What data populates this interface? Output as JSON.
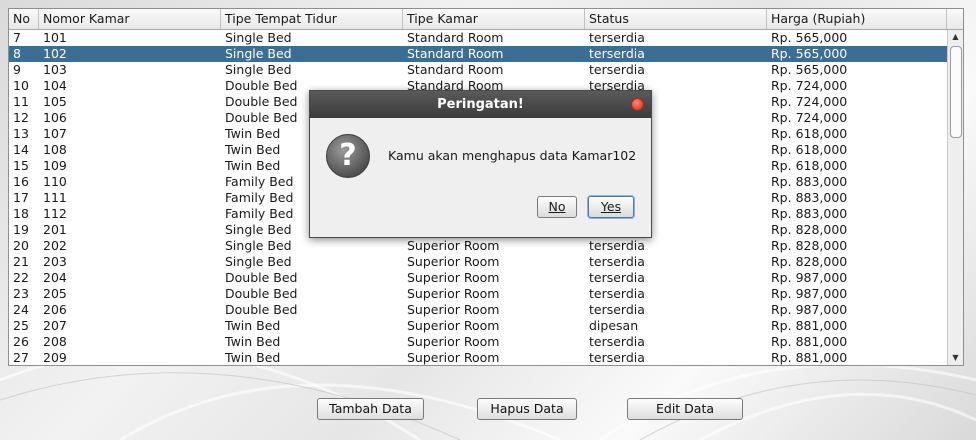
{
  "table": {
    "columns": [
      "No",
      "Nomor Kamar",
      "Tipe Tempat Tidur",
      "Tipe Kamar",
      "Status",
      "Harga (Rupiah)"
    ],
    "rows": [
      [
        "7",
        "101",
        "Single Bed",
        "Standard Room",
        "terserdia",
        "Rp. 565,000"
      ],
      [
        "8",
        "102",
        "Single Bed",
        "Standard Room",
        "terserdia",
        "Rp. 565,000"
      ],
      [
        "9",
        "103",
        "Single Bed",
        "Standard Room",
        "terserdia",
        "Rp. 565,000"
      ],
      [
        "10",
        "104",
        "Double Bed",
        "Standard Room",
        "terserdia",
        "Rp. 724,000"
      ],
      [
        "11",
        "105",
        "Double Bed",
        "",
        "",
        "Rp. 724,000"
      ],
      [
        "12",
        "106",
        "Double Bed",
        "",
        "",
        "Rp. 724,000"
      ],
      [
        "13",
        "107",
        "Twin Bed",
        "",
        "",
        "Rp. 618,000"
      ],
      [
        "14",
        "108",
        "Twin Bed",
        "",
        "",
        "Rp. 618,000"
      ],
      [
        "15",
        "109",
        "Twin Bed",
        "",
        "",
        "Rp. 618,000"
      ],
      [
        "16",
        "110",
        "Family Bed",
        "",
        "",
        "Rp. 883,000"
      ],
      [
        "17",
        "111",
        "Family Bed",
        "",
        "",
        "Rp. 883,000"
      ],
      [
        "18",
        "112",
        "Family Bed",
        "",
        "",
        "Rp. 883,000"
      ],
      [
        "19",
        "201",
        "Single Bed",
        "",
        "",
        "Rp. 828,000"
      ],
      [
        "20",
        "202",
        "Single Bed",
        "Superior Room",
        "terserdia",
        "Rp. 828,000"
      ],
      [
        "21",
        "203",
        "Single Bed",
        "Superior Room",
        "terserdia",
        "Rp. 828,000"
      ],
      [
        "22",
        "204",
        "Double Bed",
        "Superior Room",
        "terserdia",
        "Rp. 987,000"
      ],
      [
        "23",
        "205",
        "Double Bed",
        "Superior Room",
        "terserdia",
        "Rp. 987,000"
      ],
      [
        "24",
        "206",
        "Double Bed",
        "Superior Room",
        "terserdia",
        "Rp. 987,000"
      ],
      [
        "25",
        "207",
        "Twin Bed",
        "Superior Room",
        "dipesan",
        "Rp. 881,000"
      ],
      [
        "26",
        "208",
        "Twin Bed",
        "Superior Room",
        "terserdia",
        "Rp. 881,000"
      ],
      [
        "27",
        "209",
        "Twin Bed",
        "Superior Room",
        "terserdia",
        "Rp. 881,000"
      ]
    ],
    "selected_row": 1
  },
  "scrollbar": {
    "up_icon": "arrow-up-icon",
    "down_icon": "arrow-down-icon"
  },
  "buttons": {
    "add": "Tambah Data",
    "delete": "Hapus Data",
    "edit": "Edit Data"
  },
  "dialog": {
    "title": "Peringatan!",
    "message": "Kamu akan menghapus data Kamar102",
    "no_label": "No",
    "yes_label": "Yes",
    "icon": "question-icon",
    "close_icon": "close-icon"
  },
  "colors": {
    "selection": "#3a6e95",
    "dialog_title_bg": "#3b3b3b",
    "close_button": "#e0402e"
  }
}
